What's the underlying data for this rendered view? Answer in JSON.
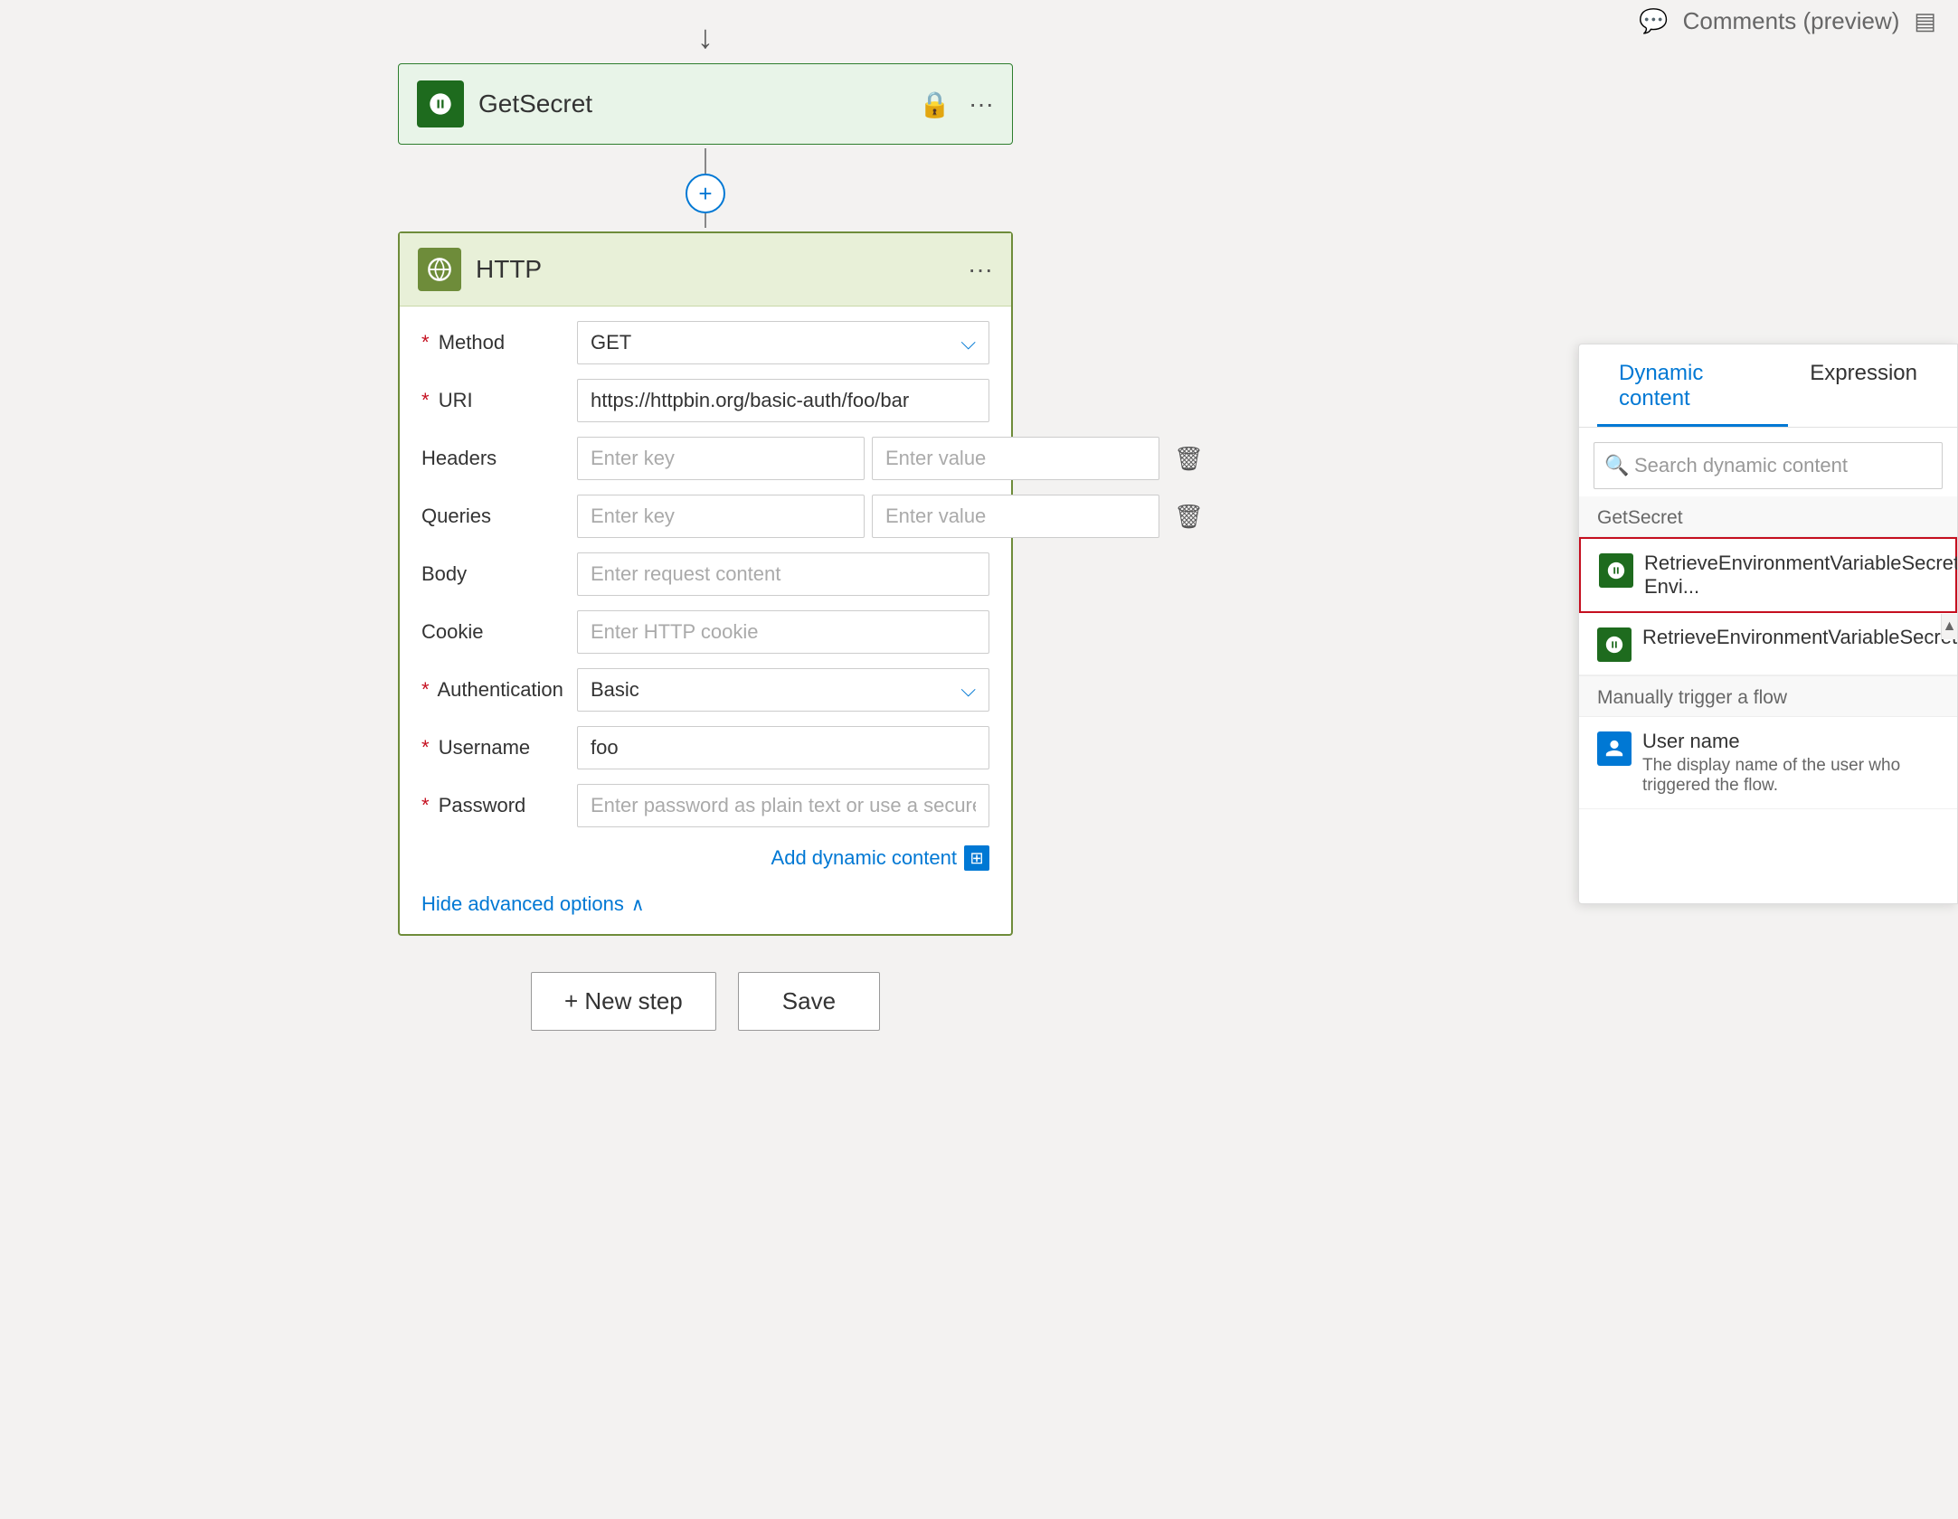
{
  "topBar": {
    "comments": "Comments (preview)"
  },
  "getSecretCard": {
    "title": "GetSecret",
    "iconSymbol": "↺"
  },
  "httpCard": {
    "title": "HTTP",
    "iconSymbol": "🌐",
    "fields": {
      "method": {
        "label": "Method",
        "value": "GET",
        "required": true
      },
      "uri": {
        "label": "URI",
        "value": "https://httpbin.org/basic-auth/foo/bar",
        "required": true
      },
      "headers": {
        "label": "Headers",
        "keyPlaceholder": "Enter key",
        "valuePlaceholder": "Enter value"
      },
      "queries": {
        "label": "Queries",
        "keyPlaceholder": "Enter key",
        "valuePlaceholder": "Enter value"
      },
      "body": {
        "label": "Body",
        "placeholder": "Enter request content"
      },
      "cookie": {
        "label": "Cookie",
        "placeholder": "Enter HTTP cookie"
      },
      "authentication": {
        "label": "Authentication",
        "value": "Basic",
        "required": true
      },
      "username": {
        "label": "Username",
        "value": "foo",
        "required": true
      },
      "password": {
        "label": "Password",
        "placeholder": "Enter password as plain text or use a secure parameter",
        "required": true
      }
    },
    "addDynamicContent": "Add dynamic content",
    "hideAdvanced": "Hide advanced options"
  },
  "actions": {
    "newStep": "+ New step",
    "save": "Save"
  },
  "dynamicPanel": {
    "tabs": [
      {
        "label": "Dynamic content",
        "active": true
      },
      {
        "label": "Expression",
        "active": false
      }
    ],
    "searchPlaceholder": "Search dynamic content",
    "sections": [
      {
        "name": "GetSecret",
        "items": [
          {
            "title": "RetrieveEnvironmentVariableSecretValueResponse Envi...",
            "highlighted": true
          },
          {
            "title": "RetrieveEnvironmentVariableSecretValueResponse",
            "highlighted": false
          }
        ]
      },
      {
        "name": "Manually trigger a flow",
        "items": [
          {
            "title": "User name",
            "description": "The display name of the user who triggered the flow.",
            "iconType": "blue"
          }
        ]
      }
    ]
  },
  "connector": {
    "plusSymbol": "+"
  },
  "arrowSymbol": "↓"
}
